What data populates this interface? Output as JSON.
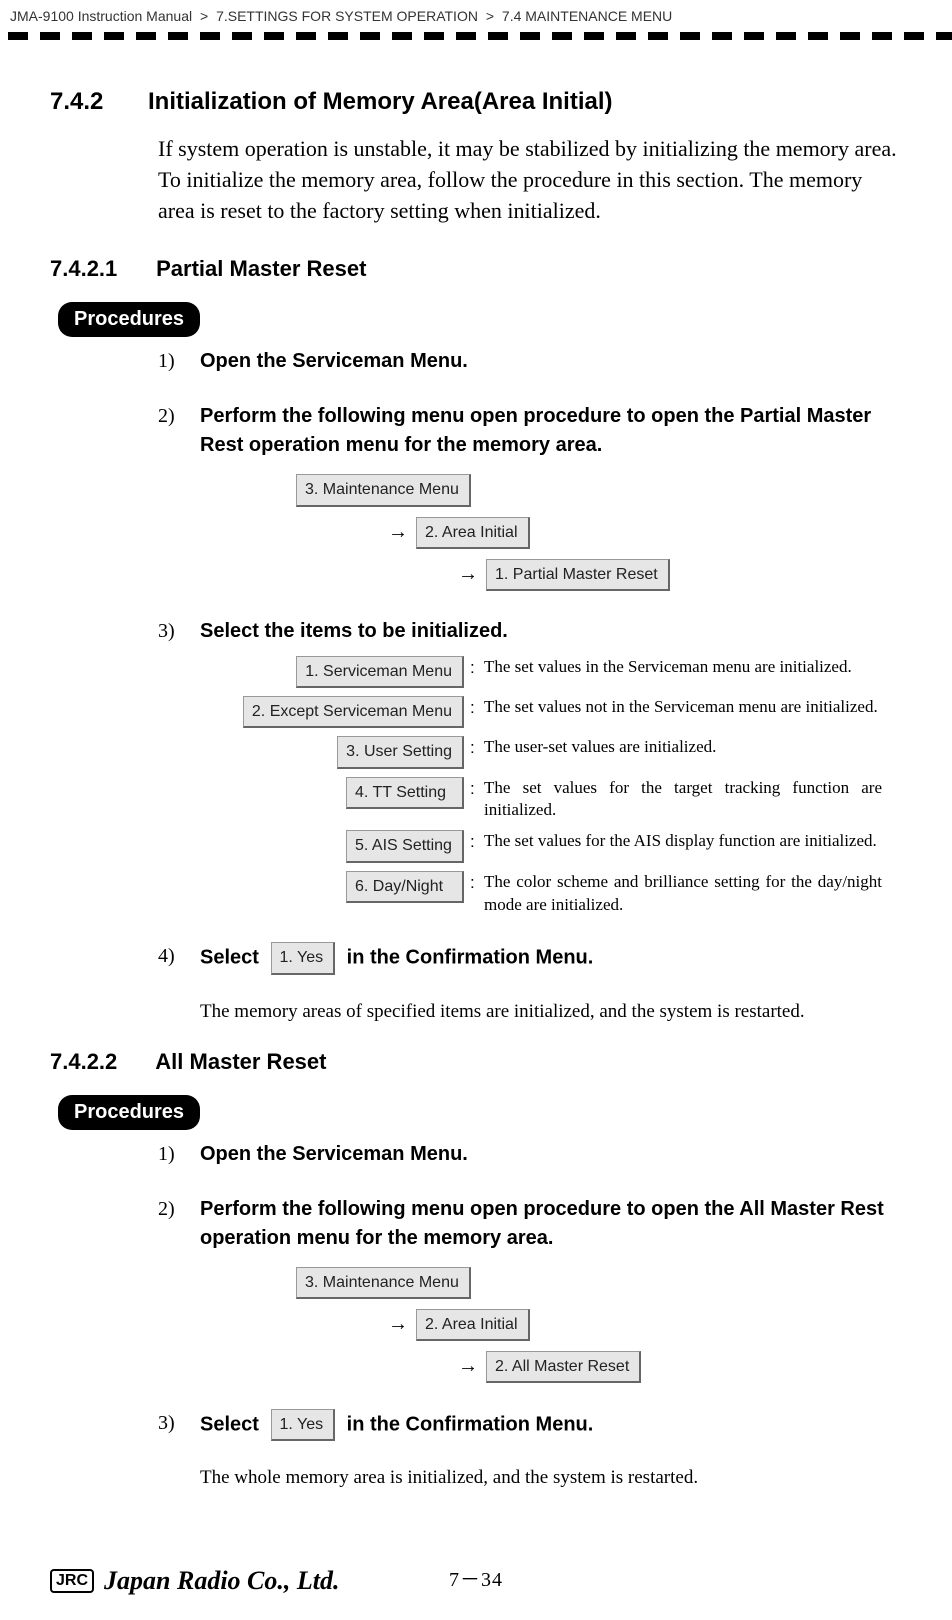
{
  "header": {
    "manual": "JMA-9100 Instruction Manual",
    "chapter": "7.SETTINGS FOR SYSTEM OPERATION",
    "section": "7.4  MAINTENANCE MENU",
    "sep": ">"
  },
  "section": {
    "num": "7.4.2",
    "title": "Initialization of Memory Area(Area Initial)",
    "intro": "If system operation is unstable, it may be stabilized by initializing the memory area. To initialize the memory area, follow the procedure in this section. The memory area is reset to the factory setting when initialized."
  },
  "s1": {
    "num": "7.4.2.1",
    "title": "Partial Master Reset",
    "procedures_label": "Procedures",
    "steps": {
      "n1": "1)",
      "n2": "2)",
      "n3": "3)",
      "n4": "4)",
      "t1": "Open the Serviceman Menu.",
      "t2": "Perform the following menu open procedure to open the Partial Master Rest operation menu for the memory area.",
      "t3": "Select the items to be initialized.",
      "t4a": "Select",
      "t4b": "in the Confirmation Menu."
    },
    "menu": {
      "arrow": "→",
      "m1": "3. Maintenance Menu",
      "m2": "2. Area Initial",
      "m3": "1. Partial Master Reset"
    },
    "options": {
      "o1": {
        "label": "1. Serviceman Menu",
        "desc": "The set values in the Serviceman menu are initialized."
      },
      "o2": {
        "label": "2. Except Serviceman Menu",
        "desc": "The set values not in the Serviceman menu are initialized."
      },
      "o3": {
        "label": "3. User Setting",
        "desc": "The user-set values are initialized."
      },
      "o4": {
        "label": "4. TT Setting",
        "desc": "The set values for the target tracking function are initialized."
      },
      "o5": {
        "label": "5. AIS Setting",
        "desc": "The set values for the AIS display function are initialized."
      },
      "o6": {
        "label": "6. Day/Night",
        "desc": "The color scheme and brilliance setting for the day/night mode are initialized."
      },
      "colon": ":"
    },
    "confirm_btn": "1. Yes",
    "note": "The memory areas of specified items are initialized, and the system is restarted."
  },
  "s2": {
    "num": "7.4.2.2",
    "title": " All Master Reset",
    "procedures_label": "Procedures",
    "steps": {
      "n1": "1)",
      "n2": "2)",
      "n3": "3)",
      "t1": "Open the Serviceman Menu.",
      "t2": "Perform the following menu open procedure to open the All Master Rest operation menu for the memory area.",
      "t3a": "Select",
      "t3b": "in the Confirmation Menu."
    },
    "menu": {
      "arrow": "→",
      "m1": "3. Maintenance Menu",
      "m2": "2. Area Initial",
      "m3": "2. All Master Reset"
    },
    "confirm_btn": "1. Yes",
    "note": "The whole memory area is initialized, and the system is restarted."
  },
  "footer": {
    "jrc": "JRC",
    "company": "Japan Radio Co., Ltd.",
    "page": "7－34"
  }
}
